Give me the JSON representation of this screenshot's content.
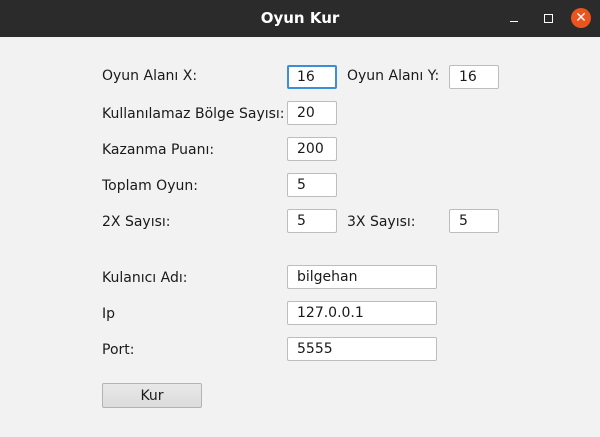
{
  "window": {
    "title": "Oyun Kur"
  },
  "form": {
    "oyun_alani_x": {
      "label": "Oyun Alanı X:",
      "value": "16"
    },
    "oyun_alani_y": {
      "label": "Oyun Alanı Y:",
      "value": "16"
    },
    "kullanilamaz_bolge": {
      "label": "Kullanılamaz Bölge Sayısı:",
      "value": "20"
    },
    "kazanma_puani": {
      "label": "Kazanma Puanı:",
      "value": "200"
    },
    "toplam_oyun": {
      "label": "Toplam Oyun:",
      "value": "5"
    },
    "sayisi_2x": {
      "label": "2X Sayısı:",
      "value": "5"
    },
    "sayisi_3x": {
      "label": "3X Sayısı:",
      "value": "5"
    },
    "kullanici_adi": {
      "label": "Kulanıcı Adı:",
      "value": "bilgehan"
    },
    "ip": {
      "label": "Ip",
      "value": "127.0.0.1"
    },
    "port": {
      "label": "Port:",
      "value": "5555"
    }
  },
  "buttons": {
    "kur_label": "Kur"
  },
  "colors": {
    "titlebar": "#2b2b2b",
    "close_button": "#e9541f",
    "focus_border": "#3a8fd8",
    "background": "#f2f2f2"
  },
  "icons": {
    "minimize": "minimize-icon",
    "maximize": "maximize-icon",
    "close": "close-icon"
  }
}
